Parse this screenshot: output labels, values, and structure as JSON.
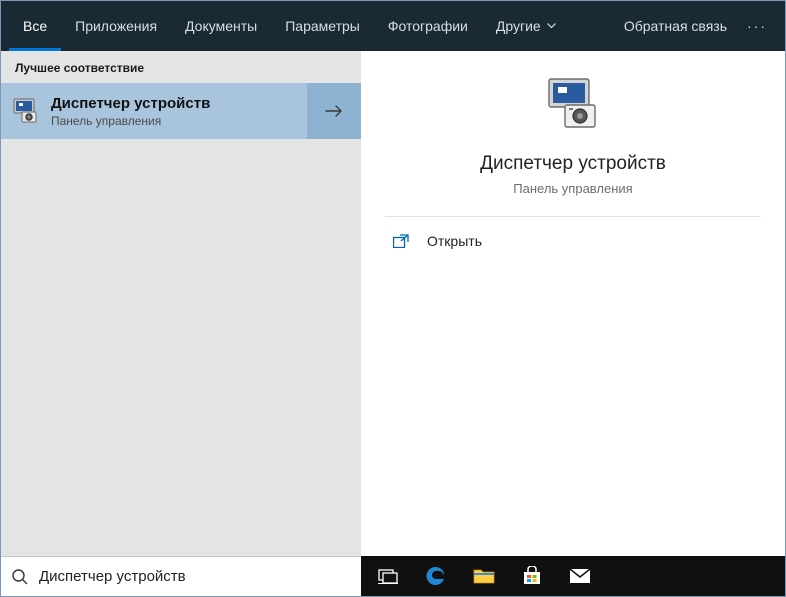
{
  "header": {
    "tabs": {
      "all": "Все",
      "apps": "Приложения",
      "docs": "Документы",
      "settings": "Параметры",
      "photos": "Фотографии",
      "other": "Другие"
    },
    "feedback": "Обратная связь",
    "more": "···"
  },
  "left": {
    "section": "Лучшее соответствие",
    "result": {
      "title": "Диспетчер устройств",
      "subtitle": "Панель управления"
    }
  },
  "preview": {
    "title": "Диспетчер устройств",
    "subtitle": "Панель управления",
    "action_open": "Открыть"
  },
  "search": {
    "value": "Диспетчер устройств",
    "placeholder": ""
  }
}
